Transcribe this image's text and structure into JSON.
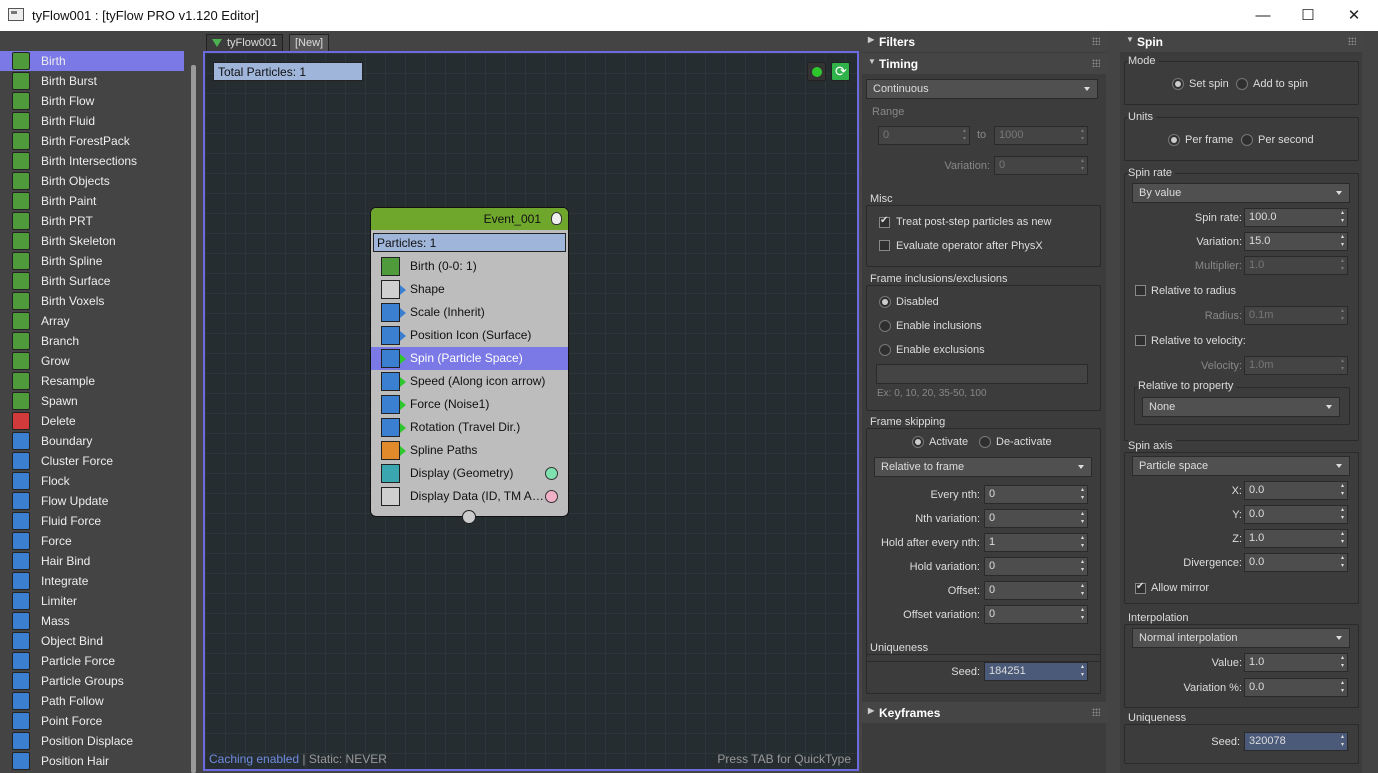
{
  "window": {
    "title": "tyFlow001 : [tyFlow PRO v1.120 Editor]",
    "minimize": "—",
    "maximize": "☐",
    "close": "✕"
  },
  "operators": [
    {
      "label": "Birth",
      "color": "#4f9a3a"
    },
    {
      "label": "Birth Burst",
      "color": "#4f9a3a"
    },
    {
      "label": "Birth Flow",
      "color": "#4f9a3a"
    },
    {
      "label": "Birth Fluid",
      "color": "#4f9a3a"
    },
    {
      "label": "Birth ForestPack",
      "color": "#4f9a3a"
    },
    {
      "label": "Birth Intersections",
      "color": "#4f9a3a"
    },
    {
      "label": "Birth Objects",
      "color": "#4f9a3a"
    },
    {
      "label": "Birth Paint",
      "color": "#4f9a3a"
    },
    {
      "label": "Birth PRT",
      "color": "#4f9a3a"
    },
    {
      "label": "Birth Skeleton",
      "color": "#4f9a3a"
    },
    {
      "label": "Birth Spline",
      "color": "#4f9a3a"
    },
    {
      "label": "Birth Surface",
      "color": "#4f9a3a"
    },
    {
      "label": "Birth Voxels",
      "color": "#4f9a3a"
    },
    {
      "label": "Array",
      "color": "#4f9a3a"
    },
    {
      "label": "Branch",
      "color": "#4f9a3a"
    },
    {
      "label": "Grow",
      "color": "#4f9a3a"
    },
    {
      "label": "Resample",
      "color": "#4f9a3a"
    },
    {
      "label": "Spawn",
      "color": "#4f9a3a"
    },
    {
      "label": "Delete",
      "color": "#d03a3a"
    },
    {
      "label": "Boundary",
      "color": "#3a7fd0"
    },
    {
      "label": "Cluster Force",
      "color": "#3a7fd0"
    },
    {
      "label": "Flock",
      "color": "#3a7fd0"
    },
    {
      "label": "Flow Update",
      "color": "#3a7fd0"
    },
    {
      "label": "Fluid Force",
      "color": "#3a7fd0"
    },
    {
      "label": "Force",
      "color": "#3a7fd0"
    },
    {
      "label": "Hair Bind",
      "color": "#3a7fd0"
    },
    {
      "label": "Integrate",
      "color": "#3a7fd0"
    },
    {
      "label": "Limiter",
      "color": "#3a7fd0"
    },
    {
      "label": "Mass",
      "color": "#3a7fd0"
    },
    {
      "label": "Object Bind",
      "color": "#3a7fd0"
    },
    {
      "label": "Particle Force",
      "color": "#3a7fd0"
    },
    {
      "label": "Particle Groups",
      "color": "#3a7fd0"
    },
    {
      "label": "Path Follow",
      "color": "#3a7fd0"
    },
    {
      "label": "Point Force",
      "color": "#3a7fd0"
    },
    {
      "label": "Position Displace",
      "color": "#3a7fd0"
    },
    {
      "label": "Position Hair",
      "color": "#3a7fd0"
    }
  ],
  "tabs": [
    {
      "label": "tyFlow001"
    },
    {
      "label": "[New]"
    }
  ],
  "canvas": {
    "total_particles": "Total Particles: 1",
    "caching": "Caching enabled",
    "static": " | Static: NEVER",
    "quicktype": "Press TAB for QuickType"
  },
  "event": {
    "name": "Event_001",
    "particles": "Particles: 1",
    "operators": [
      {
        "label": "Birth (0-0: 1)",
        "icon_color": "#4f9a3a",
        "arrow": "none",
        "circle": ""
      },
      {
        "label": "Shape",
        "icon_color": "#cfcfcf",
        "arrow": "#3a7fd0",
        "circle": ""
      },
      {
        "label": "Scale (Inherit)",
        "icon_color": "#3a7fd0",
        "arrow": "#3a7fd0",
        "circle": ""
      },
      {
        "label": "Position Icon (Surface)",
        "icon_color": "#3a7fd0",
        "arrow": "#3a7fd0",
        "circle": ""
      },
      {
        "label": "Spin (Particle Space)",
        "icon_color": "#3a7fd0",
        "arrow": "#2ec72e",
        "circle": ""
      },
      {
        "label": "Speed (Along icon arrow)",
        "icon_color": "#3a7fd0",
        "arrow": "#2ec72e",
        "circle": ""
      },
      {
        "label": "Force (Noise1)",
        "icon_color": "#3a7fd0",
        "arrow": "#2ec72e",
        "circle": ""
      },
      {
        "label": "Rotation (Travel Dir.)",
        "icon_color": "#3a7fd0",
        "arrow": "#2ec72e",
        "circle": ""
      },
      {
        "label": "Spline Paths",
        "icon_color": "#e08a2c",
        "arrow": "#2ec72e",
        "circle": ""
      },
      {
        "label": "Display (Geometry)",
        "icon_color": "#3aa7b0",
        "arrow": "none",
        "circle": "#7fe0b0"
      },
      {
        "label": "Display Data (ID, TM Axes)",
        "icon_color": "#cfcfcf",
        "arrow": "none",
        "circle": "#f0b0c8"
      }
    ]
  },
  "mid": {
    "filters": "Filters",
    "timing": "Timing",
    "timing_mode": "Continuous",
    "range": "Range",
    "range_from": "0",
    "range_to_label": "to",
    "range_to": "1000",
    "variation_label": "Variation:",
    "variation": "0",
    "misc": "Misc",
    "treat_post": "Treat post-step particles as new",
    "evaluate_after": "Evaluate operator after PhysX",
    "frame_incl": "Frame inclusions/exclusions",
    "disabled": "Disabled",
    "enable_incl": "Enable inclusions",
    "enable_excl": "Enable exclusions",
    "incl_hint": "Ex: 0, 10, 20, 35-50, 100",
    "frame_skipping": "Frame skipping",
    "activate": "Activate",
    "deactivate": "De-activate",
    "relative_to": "Relative to frame",
    "every_nth_label": "Every nth:",
    "every_nth": "0",
    "nth_var_label": "Nth variation:",
    "nth_var": "0",
    "hold_label": "Hold after every nth:",
    "hold": "1",
    "hold_var_label": "Hold variation:",
    "hold_var": "0",
    "offset_label": "Offset:",
    "offset": "0",
    "offset_var_label": "Offset variation:",
    "offset_var": "0",
    "uniqueness": "Uniqueness",
    "seed_label": "Seed:",
    "seed": "184251",
    "keyframes": "Keyframes"
  },
  "spin": {
    "title": "Spin",
    "mode": "Mode",
    "set_spin": "Set spin",
    "add_spin": "Add to spin",
    "units": "Units",
    "per_frame": "Per frame",
    "per_second": "Per second",
    "spin_rate": "Spin rate",
    "spin_rate_mode": "By value",
    "rate_label": "Spin rate:",
    "rate": "100.0",
    "variation_label": "Variation:",
    "variation": "15.0",
    "multiplier_label": "Multiplier:",
    "multiplier": "1.0",
    "rel_radius": "Relative to radius",
    "radius_label": "Radius:",
    "radius": "0.1m",
    "rel_velocity": "Relative to velocity:",
    "velocity_label": "Velocity:",
    "velocity": "1.0m",
    "rel_property": "Relative to property",
    "property": "None",
    "spin_axis": "Spin axis",
    "axis_space": "Particle space",
    "x_label": "X:",
    "x": "0.0",
    "y_label": "Y:",
    "y": "0.0",
    "z_label": "Z:",
    "z": "1.0",
    "divergence_label": "Divergence:",
    "divergence": "0.0",
    "allow_mirror": "Allow mirror",
    "interpolation": "Interpolation",
    "interp_mode": "Normal interpolation",
    "value_label": "Value:",
    "value": "1.0",
    "var_pct_label": "Variation %:",
    "var_pct": "0.0",
    "uniqueness": "Uniqueness",
    "seed_label": "Seed:",
    "seed": "320078"
  }
}
